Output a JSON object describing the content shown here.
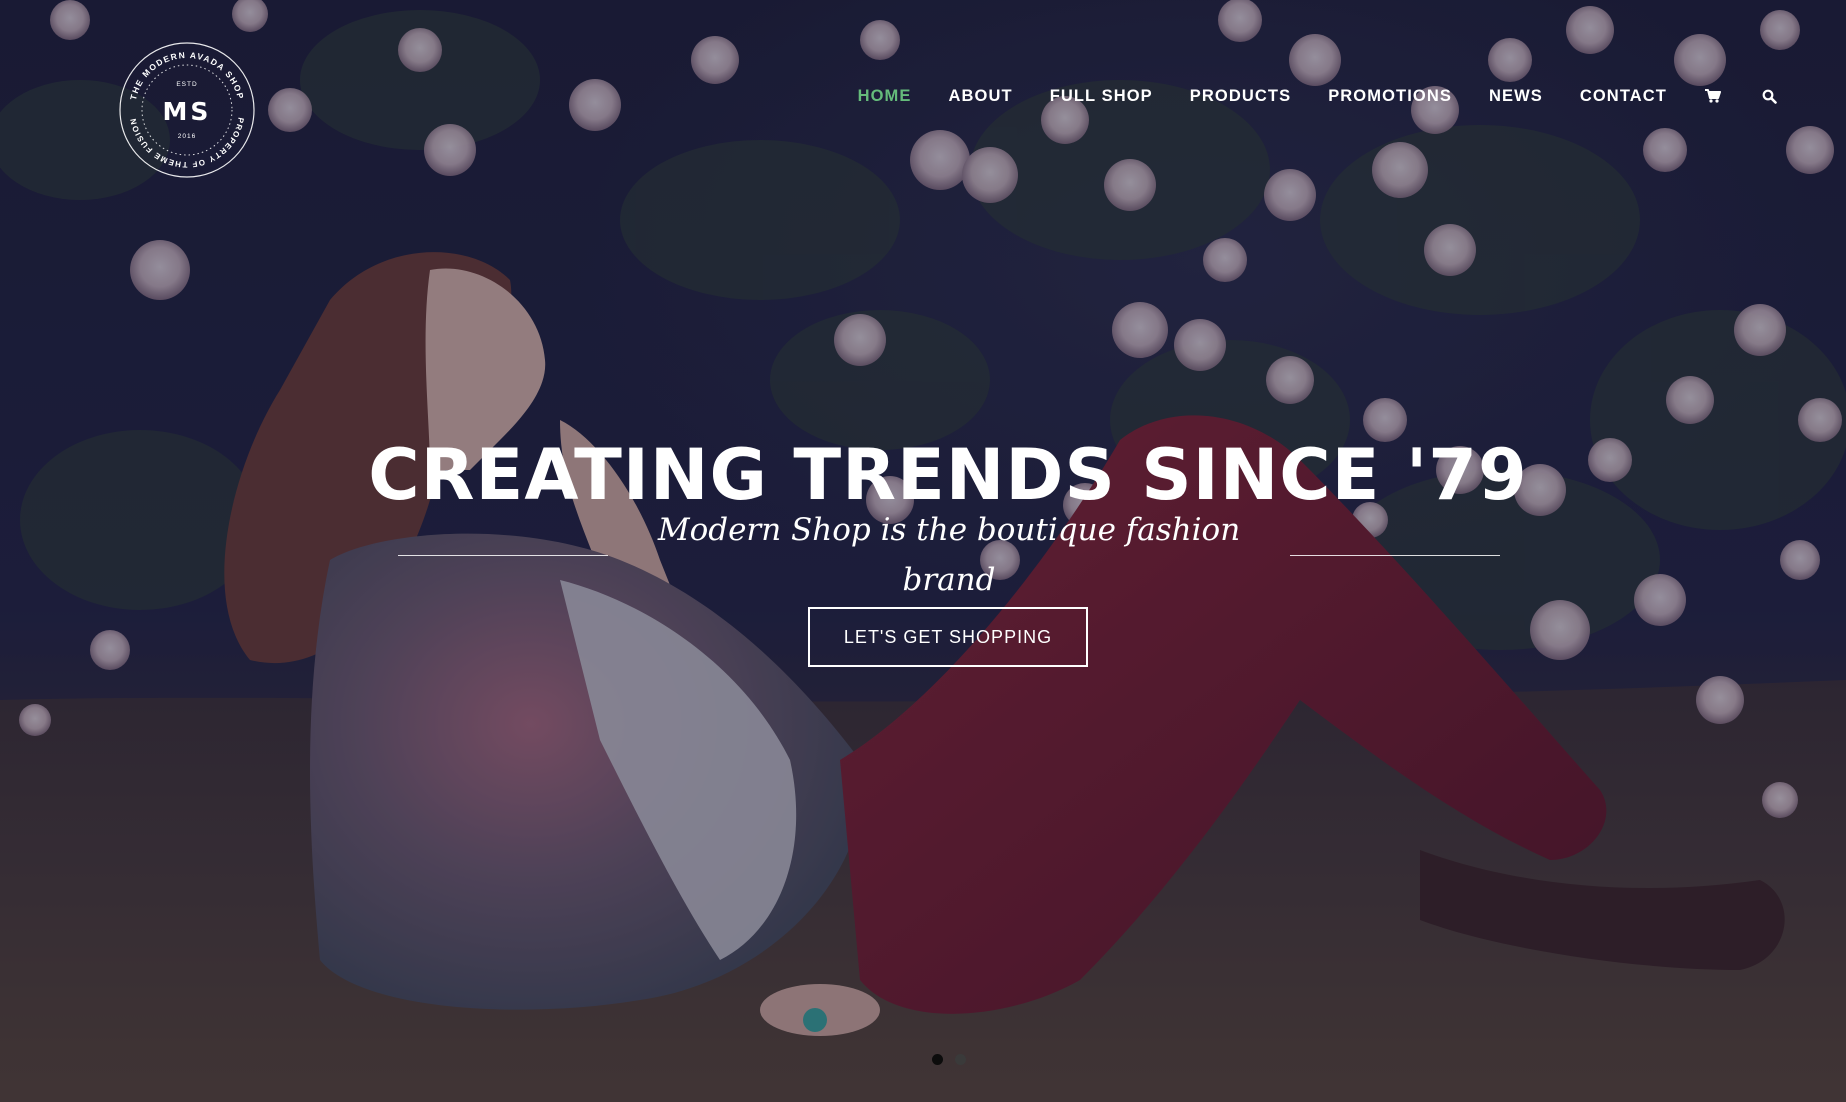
{
  "brand": {
    "monogram": "MS",
    "estd_label": "ESTD",
    "year": "2016",
    "ring_text_top": "THE MODERN AVADA SHOP",
    "ring_text_bottom": "PROPERTY OF THEME FUSION"
  },
  "nav": {
    "items": [
      {
        "label": "HOME",
        "active": true
      },
      {
        "label": "ABOUT",
        "active": false
      },
      {
        "label": "FULL SHOP",
        "active": false
      },
      {
        "label": "PRODUCTS",
        "active": false
      },
      {
        "label": "PROMOTIONS",
        "active": false
      },
      {
        "label": "NEWS",
        "active": false
      },
      {
        "label": "CONTACT",
        "active": false
      }
    ],
    "icons": [
      "cart-icon",
      "search-icon"
    ],
    "active_color": "#65bc7b"
  },
  "hero": {
    "headline": "CREATING TRENDS SINCE '79",
    "subline": "Modern Shop is the boutique fashion brand",
    "cta_label": "LET'S GET SHOPPING"
  },
  "slider": {
    "slide_count": 2,
    "active_index": 0
  }
}
